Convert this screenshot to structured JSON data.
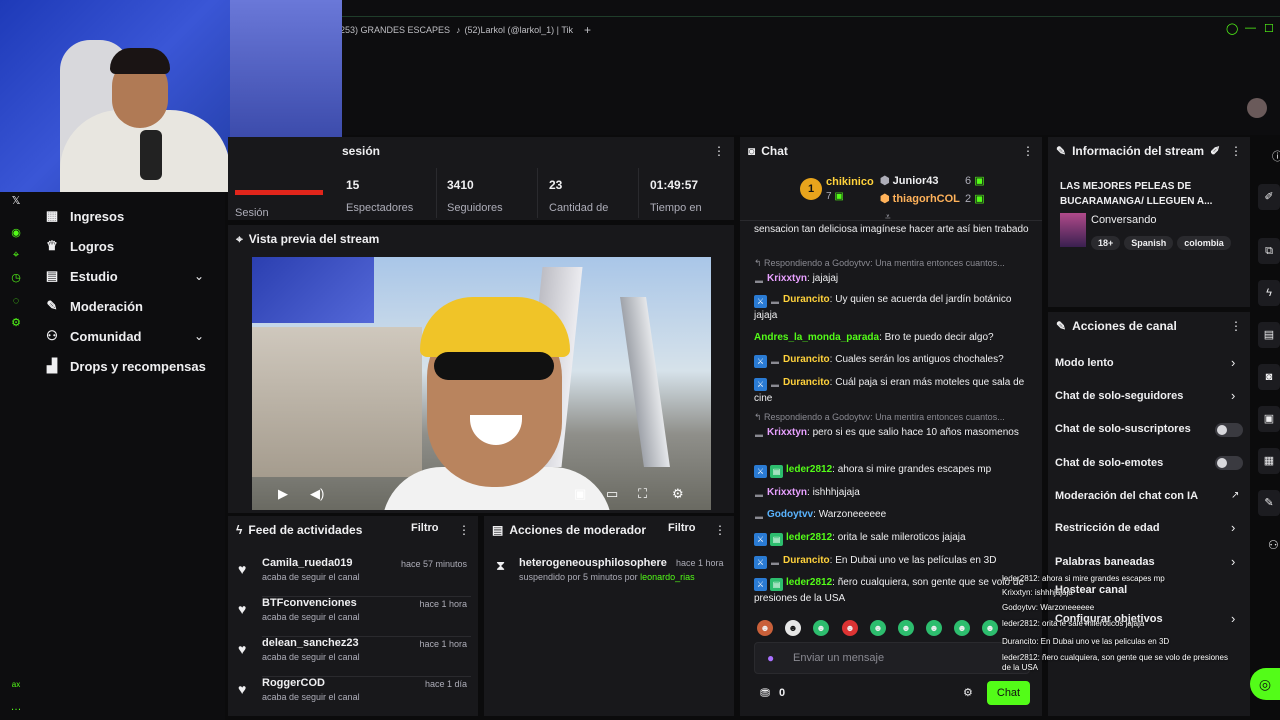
{
  "browser": {
    "tabs": [
      {
        "label": "253) GRANDES ESCAPES"
      },
      {
        "label": "(52)Larkol (@larkol_1) | Tik"
      }
    ],
    "new_tab": "+"
  },
  "session": {
    "title": "sesión",
    "session_label": "Sesión",
    "stats": [
      {
        "value": "15",
        "label": "Espectadores"
      },
      {
        "value": "3410",
        "label": "Seguidores"
      },
      {
        "value": "23",
        "label": "Cantidad de"
      },
      {
        "value": "01:49:57",
        "label": "Tiempo en"
      }
    ]
  },
  "nav": {
    "x_label": "𝕏",
    "items": [
      {
        "label": "Ingresos"
      },
      {
        "label": "Logros"
      },
      {
        "label": "Estudio"
      },
      {
        "label": "Moderación"
      },
      {
        "label": "Comunidad"
      },
      {
        "label": "Drops y recompensas"
      }
    ],
    "bottom_label": "ax"
  },
  "preview": {
    "title": "Vista previa del stream"
  },
  "feed": {
    "title": "Feed de actividades",
    "filter": "Filtro",
    "rows": [
      {
        "name": "Camila_rueda019",
        "sub": "acaba de seguir el canal",
        "time": "hace 57 minutos"
      },
      {
        "name": "BTFconvenciones",
        "sub": "acaba de seguir el canal",
        "time": "hace 1 hora"
      },
      {
        "name": "delean_sanchez23",
        "sub": "acaba de seguir el canal",
        "time": "hace 1 hora"
      },
      {
        "name": "RoggerCOD",
        "sub": "acaba de seguir el canal",
        "time": "hace 1 día"
      }
    ]
  },
  "modactions": {
    "title": "Acciones de moderador",
    "filter": "Filtro",
    "row": {
      "name": "heterogeneousphilosophere",
      "time": "hace 1 hora",
      "text": "suspendido por 5 minutos por",
      "by": "leonardo_rias"
    }
  },
  "chat": {
    "title": "Chat",
    "leaders": {
      "first": {
        "name": "chikinico",
        "rank": "1",
        "count": "7"
      },
      "second": {
        "name": "Junior43",
        "count": "6"
      },
      "third": {
        "name": "thiagorhCOL",
        "count": "2"
      }
    },
    "top_text": "sensacion tan deliciosa imagínese hacer arte así bien trabado",
    "messages": [
      {
        "reply": "Respondiendo a Godoytvv: Una mentira entonces cuantos..."
      },
      {
        "user": "Krixxtyn",
        "text": "jajajaj",
        "color": "#e8a0ff"
      },
      {
        "user": "Durancito",
        "text": "Uy quien se acuerda del jardín botánico jajaja",
        "color": "#ffd23c"
      },
      {
        "user": "Andres_la_monda_parada",
        "text": "Bro te puedo decir algo?",
        "color": "#53fc18"
      },
      {
        "user": "Durancito",
        "text": "Cuales serán los antiguos chochales?",
        "color": "#ffd23c"
      },
      {
        "user": "Durancito",
        "text": "Cuál paja si eran más moteles que sala de cine",
        "color": "#ffd23c"
      },
      {
        "reply": "Respondiendo a Godoytvv: Una mentira entonces cuantos..."
      },
      {
        "user": "Krixxtyn",
        "text": "pero si es que salio hace 10 años masomenos",
        "color": "#e8a0ff"
      },
      {
        "user": "leder2812",
        "text": "ahora si mire grandes escapes mp",
        "color": "#53fc18"
      },
      {
        "user": "Krixxtyn",
        "text": "ishhhjajaja",
        "color": "#e8a0ff"
      },
      {
        "user": "Godoytvv",
        "text": "Warzoneeeeee",
        "color": "#5ab4ff"
      },
      {
        "user": "leder2812",
        "text": "orita le sale mileroticos jajaja",
        "color": "#53fc18"
      },
      {
        "user": "Durancito",
        "text": "En Dubai uno ve las películas en 3D",
        "color": "#ffd23c"
      },
      {
        "user": "leder2812",
        "text": "ñero cualquiera, son gente que se volo de presiones de la USA",
        "color": "#53fc18"
      }
    ],
    "input_placeholder": "Enviar un mensaje",
    "points": "0",
    "send": "Chat"
  },
  "overlay": [
    "leder2812: ahora si mire grandes escapes mp",
    "Krixxtyn: ishhhjajaja",
    "Godoytvv: Warzoneeeeee",
    "leder2812: orita le sale mileroticos jajaja",
    "Durancito: En Dubai uno ve las peliculas en 3D",
    "leder2812: ñero cualquiera, son gente que se volo de presiones de la USA"
  ],
  "info": {
    "title": "Información del stream",
    "stream_title": "LAS MEJORES PELEAS DE BUCARAMANGA/ LLEGUEN A...",
    "category": "Conversando",
    "tags": [
      "18+",
      "Spanish",
      "colombia"
    ]
  },
  "channel": {
    "title": "Acciones de canal",
    "items": [
      {
        "label": "Modo lento",
        "type": "arrow"
      },
      {
        "label": "Chat de solo-seguidores",
        "type": "arrow"
      },
      {
        "label": "Chat de solo-suscriptores",
        "type": "toggle"
      },
      {
        "label": "Chat de solo-emotes",
        "type": "toggle"
      },
      {
        "label": "Moderación del chat con IA",
        "type": "link"
      },
      {
        "label": "Restricción de edad",
        "type": "arrow"
      },
      {
        "label": "Palabras baneadas",
        "type": "arrow"
      },
      {
        "label": "Hostear canal",
        "type": "none"
      },
      {
        "label": "Configurar objetivos",
        "type": "arrow"
      }
    ]
  },
  "colors": {
    "accent": "#53fc18",
    "panel": "#18181b",
    "bg": "#0b0b0c"
  }
}
